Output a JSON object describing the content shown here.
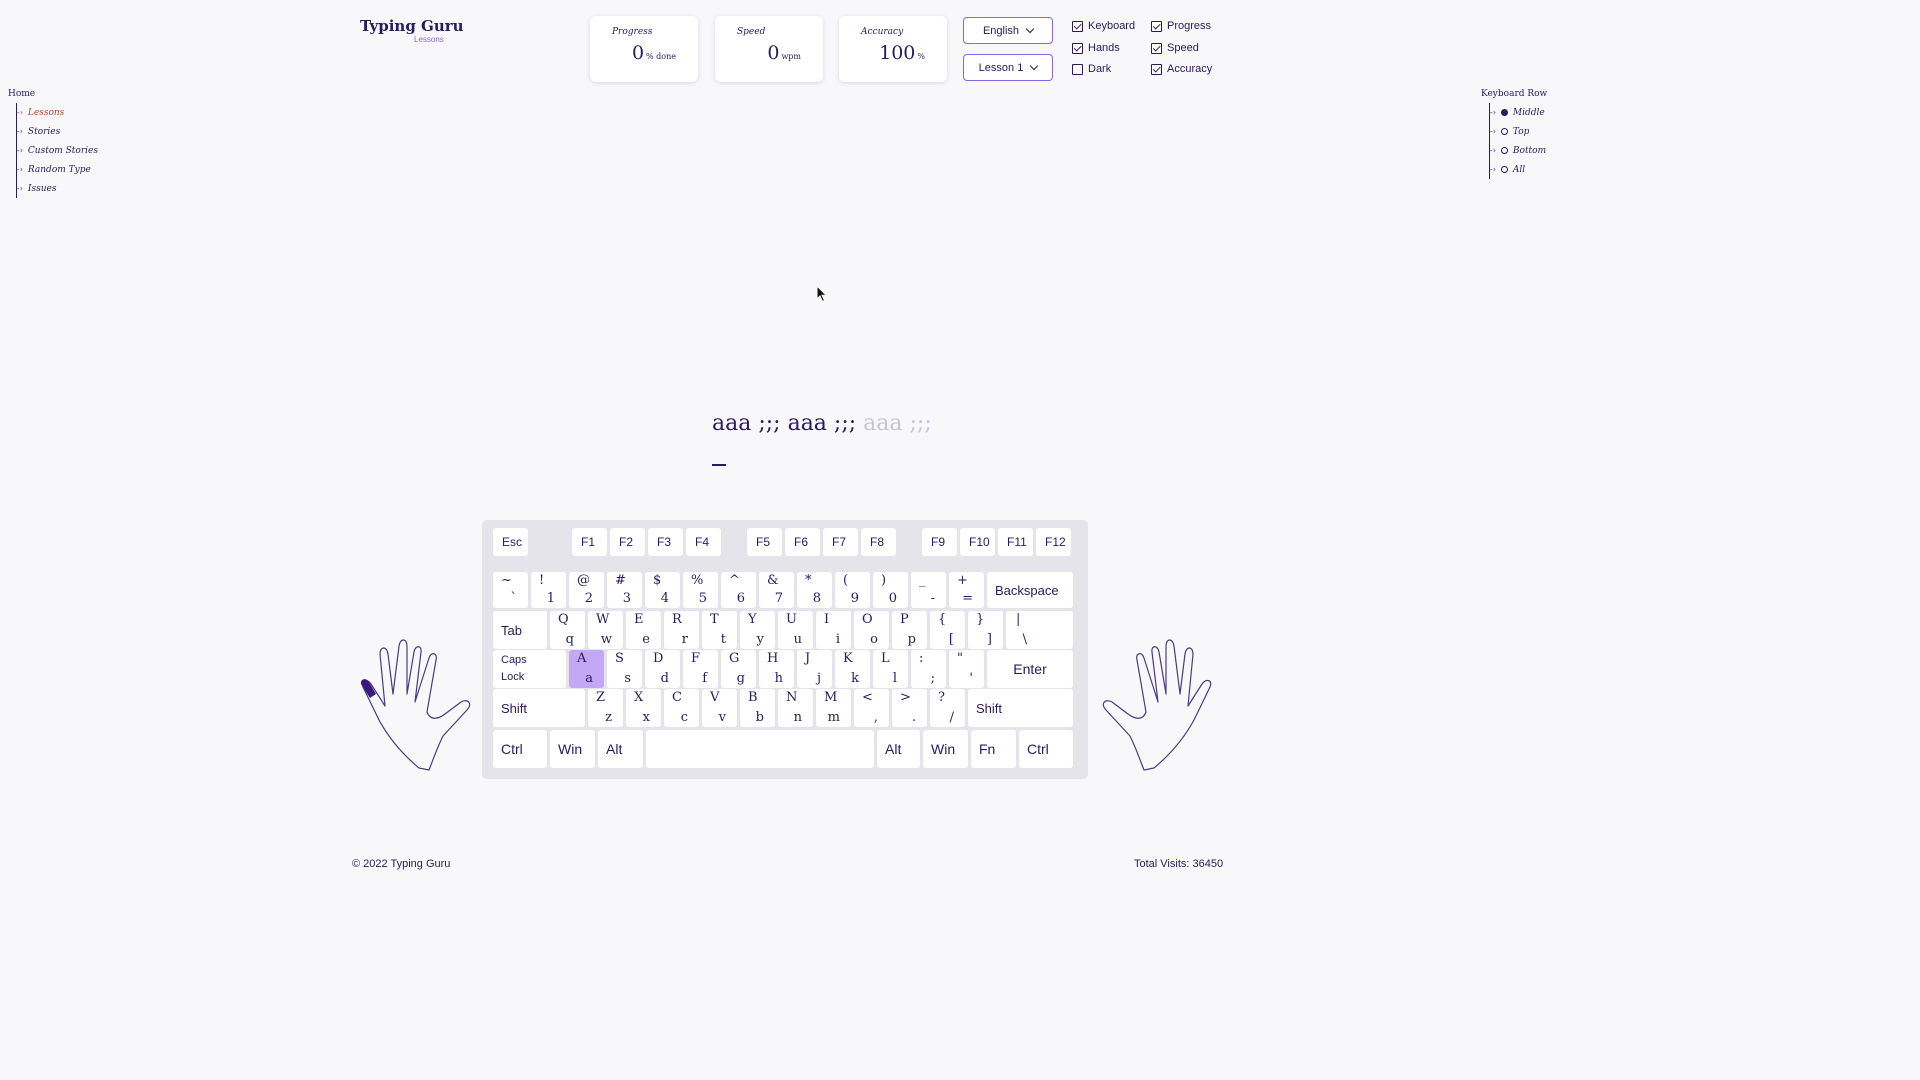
{
  "logo": {
    "title": "Typing Guru",
    "subtitle": "Lessons"
  },
  "stats": {
    "progress": {
      "label": "Progress",
      "value": "0",
      "unit": "% done"
    },
    "speed": {
      "label": "Speed",
      "value": "0",
      "unit": "wpm"
    },
    "accuracy": {
      "label": "Accuracy",
      "value": "100",
      "unit": "%"
    }
  },
  "selects": {
    "language": "English",
    "lesson": "Lesson 1"
  },
  "toggles": {
    "keyboard": {
      "label": "Keyboard",
      "checked": true
    },
    "hands": {
      "label": "Hands",
      "checked": true
    },
    "dark": {
      "label": "Dark",
      "checked": false
    },
    "progress": {
      "label": "Progress",
      "checked": true
    },
    "speed": {
      "label": "Speed",
      "checked": true
    },
    "accuracy": {
      "label": "Accuracy",
      "checked": true
    }
  },
  "nav": {
    "home": "Home",
    "items": [
      {
        "label": "Lessons",
        "active": true
      },
      {
        "label": "Stories",
        "active": false
      },
      {
        "label": "Custom Stories",
        "active": false
      },
      {
        "label": "Random Type",
        "active": false
      },
      {
        "label": "Issues",
        "active": false
      }
    ]
  },
  "rows": {
    "title": "Keyboard Row",
    "items": [
      {
        "label": "Middle",
        "selected": true
      },
      {
        "label": "Top",
        "selected": false
      },
      {
        "label": "Bottom",
        "selected": false
      },
      {
        "label": "All",
        "selected": false
      }
    ]
  },
  "typing": {
    "done": "aaa ;;; aaa ;;; ",
    "remaining": "aaa ;;;"
  },
  "keyboard": {
    "active_key": "A",
    "colors": {
      "accent": "#8a63e6",
      "active_key": "#c3a8f6",
      "text": "#2a1a5e",
      "active_finger": "#3a1a7a"
    }
  },
  "hands": {
    "active_finger": "left-pinky"
  },
  "footer": {
    "copyright": "© 2022 Typing Guru",
    "visits": "Total Visits: 36450"
  }
}
